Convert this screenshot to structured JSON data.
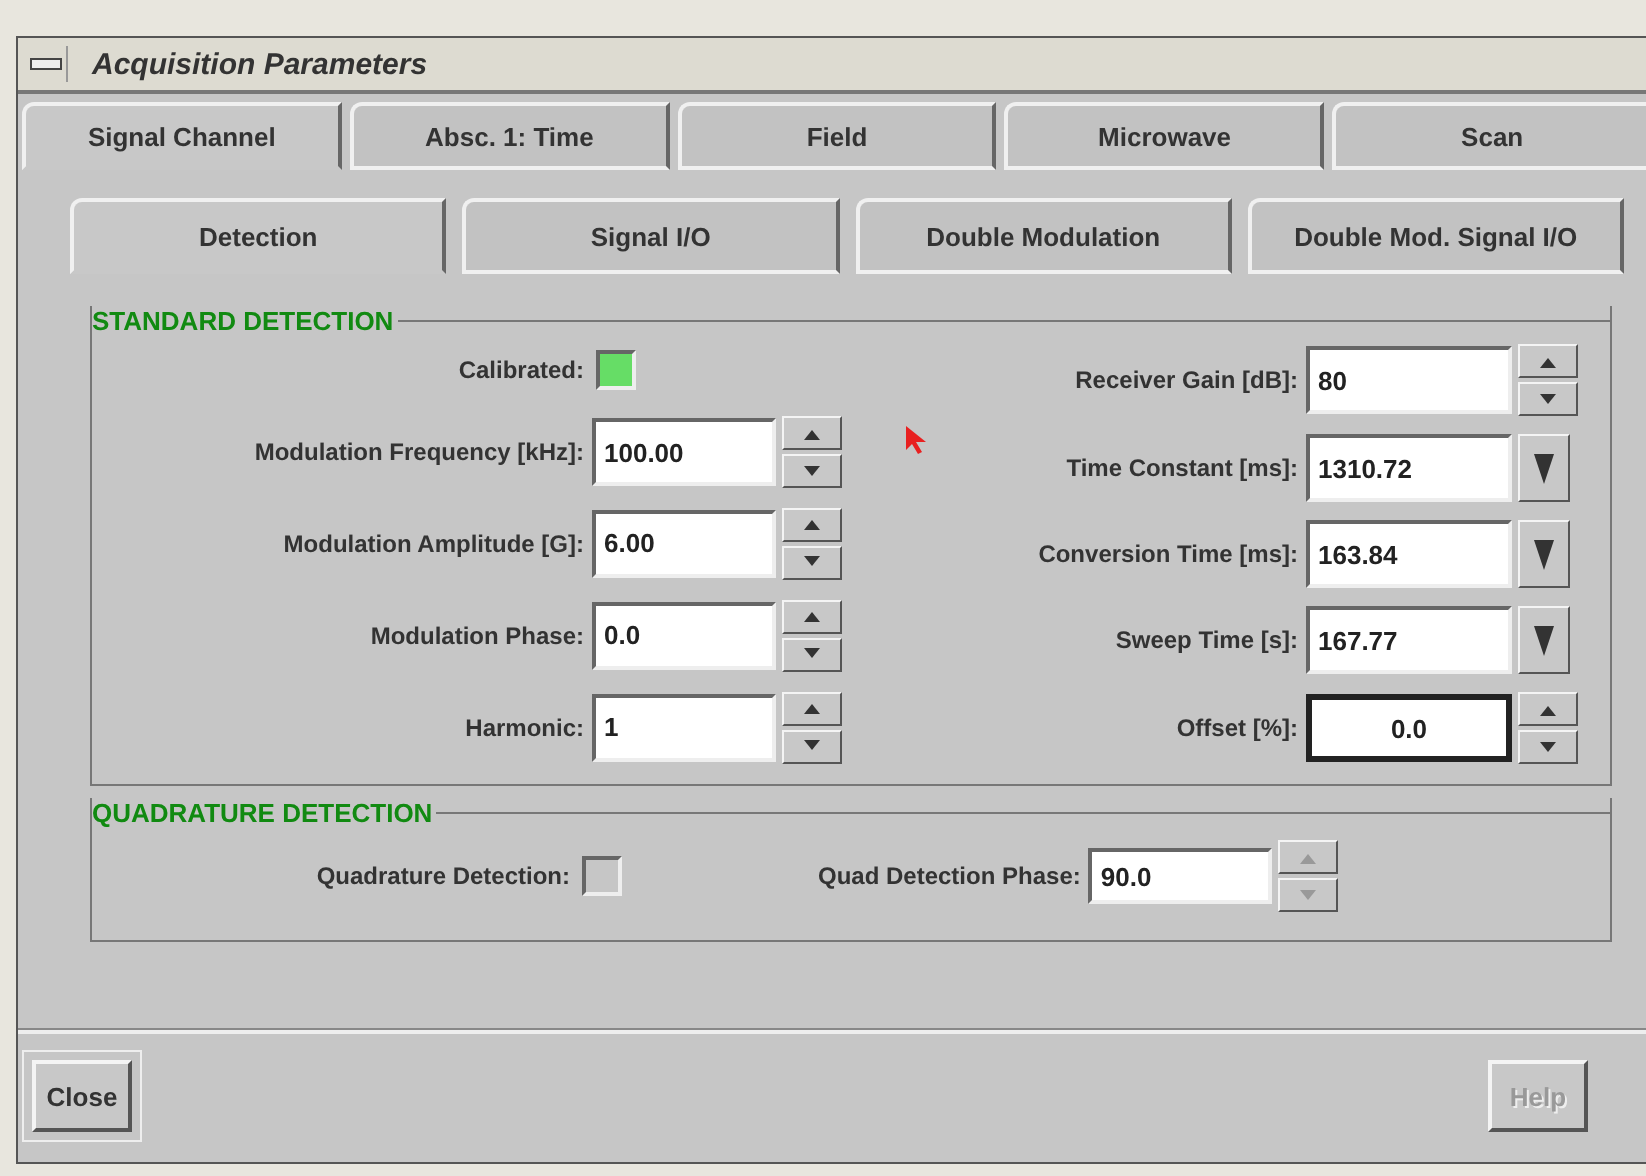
{
  "window": {
    "title": "Acquisition Parameters"
  },
  "tabs": [
    {
      "label": "Signal Channel",
      "selected": true
    },
    {
      "label": "Absc. 1: Time",
      "selected": false
    },
    {
      "label": "Field",
      "selected": false
    },
    {
      "label": "Microwave",
      "selected": false
    },
    {
      "label": "Scan",
      "selected": false
    }
  ],
  "subtabs": [
    {
      "label": "Detection",
      "selected": true
    },
    {
      "label": "Signal I/O",
      "selected": false
    },
    {
      "label": "Double Modulation",
      "selected": false
    },
    {
      "label": "Double Mod. Signal I/O",
      "selected": false
    }
  ],
  "groups": [
    {
      "title": "STANDARD DETECTION",
      "kind": "columns",
      "left": [
        {
          "label": "Calibrated:",
          "kind": "indicator",
          "checked": true
        },
        {
          "label": "Modulation Frequency [kHz]:",
          "kind": "spin",
          "value": "100.00",
          "focused": false,
          "disabled": false
        },
        {
          "label": "Modulation Amplitude [G]:",
          "kind": "spin",
          "value": "6.00",
          "focused": false,
          "disabled": false
        },
        {
          "label": "Modulation Phase:",
          "kind": "spin",
          "value": "0.0",
          "focused": false,
          "disabled": false
        },
        {
          "label": "Harmonic:",
          "kind": "spin",
          "value": "1",
          "focused": false,
          "disabled": false
        }
      ],
      "right": [
        {
          "label": "Receiver Gain [dB]:",
          "kind": "spin",
          "value": "80",
          "focused": false,
          "disabled": false
        },
        {
          "label": "Time Constant [ms]:",
          "kind": "dropdown",
          "value": "1310.72",
          "focused": false
        },
        {
          "label": "Conversion Time [ms]:",
          "kind": "dropdown",
          "value": "163.84",
          "focused": false
        },
        {
          "label": "Sweep Time [s]:",
          "kind": "dropdown",
          "value": "167.77",
          "focused": false
        },
        {
          "label": "Offset [%]:",
          "kind": "spin",
          "value": "0.0",
          "focused": true,
          "disabled": false
        }
      ]
    },
    {
      "title": "QUADRATURE DETECTION",
      "kind": "row",
      "left": [
        {
          "label": "Quadrature Detection:",
          "kind": "indicator",
          "checked": false
        }
      ],
      "right": [
        {
          "label": "Quad Detection Phase:",
          "kind": "spin",
          "value": "90.0",
          "focused": false,
          "disabled": true
        }
      ]
    }
  ],
  "buttons": [
    {
      "label": "Close",
      "disabled": false
    },
    {
      "label": "Help",
      "disabled": true
    }
  ]
}
